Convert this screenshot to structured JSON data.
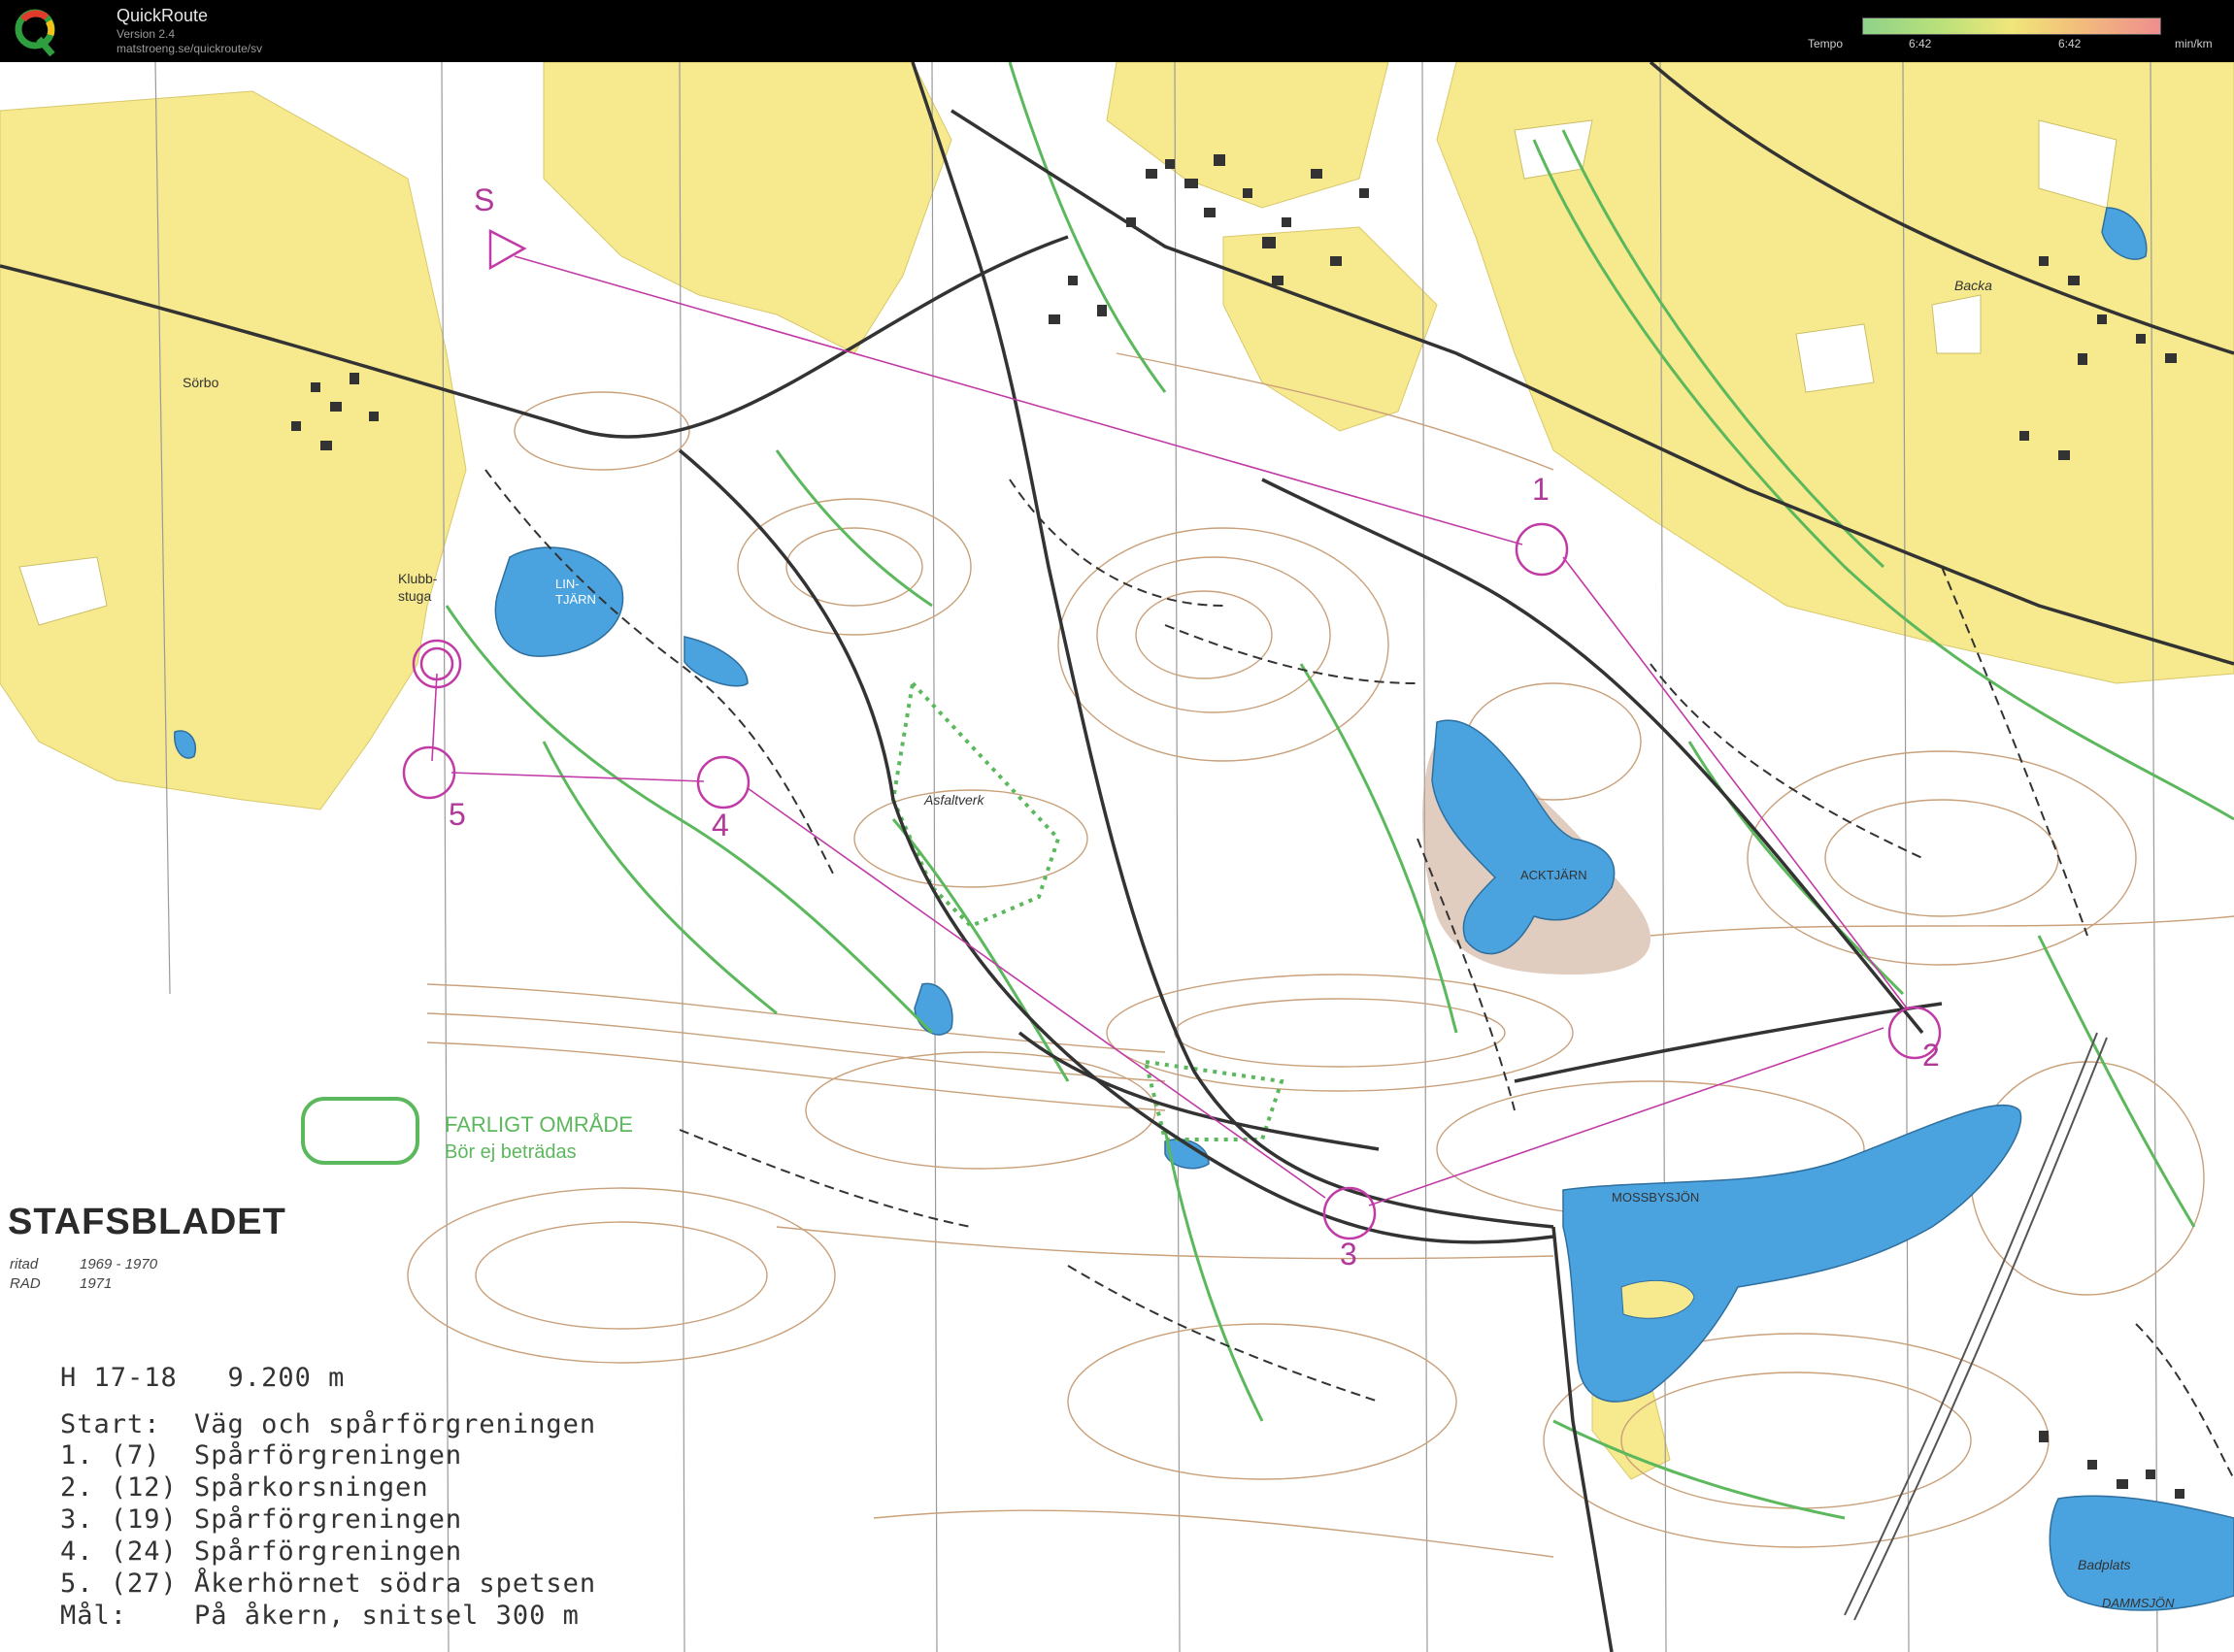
{
  "app": {
    "name": "QuickRoute",
    "version": "Version 2.4",
    "url": "matstroeng.se/quickroute/sv"
  },
  "tempo": {
    "label": "Tempo",
    "left_value": "6:42",
    "right_value": "6:42",
    "unit": "min/km"
  },
  "map": {
    "title": "STAFSBLADET",
    "drawn_label": "ritad",
    "drawn_years": "1969 - 1970",
    "rad_label": "RAD",
    "rad_year": "1971",
    "legend_danger_title": "FARLIGT OMRÅDE",
    "legend_danger_sub": "Bör ej beträdas",
    "place_names": {
      "sorbo": "Sörbo",
      "klubbstuga_1": "Klubb-",
      "klubbstuga_2": "stuga",
      "lintjarn_1": "LIN-",
      "lintjarn_2": "TJÄRN",
      "asfaltverk": "Asfaltverk",
      "acktjarn": "ACKTJÄRN",
      "backa": "Backa",
      "mossbysjon": "MOSSBYSJÖN",
      "badplats": "Badplats",
      "dammsjon": "DAMMSJÖN"
    },
    "controls": [
      "S",
      "1",
      "2",
      "3",
      "4",
      "5"
    ],
    "colors": {
      "course": "#c23aa6",
      "water": "#4aa3df",
      "field": "#f6e98e",
      "vegetation_line": "#5cb85c",
      "road": "#333333"
    }
  },
  "course": {
    "class_line": "H 17-18   9.200 m",
    "start": "Start:  Väg och spårförgreningen",
    "c1": "1. (7)  Spårförgreningen",
    "c2": "2. (12) Spårkorsningen",
    "c3": "3. (19) Spårförgreningen",
    "c4": "4. (24) Spårförgreningen",
    "c5": "5. (27) Åkerhörnet södra spetsen",
    "finish": "Mål:    På åkern, snitsel 300 m"
  }
}
